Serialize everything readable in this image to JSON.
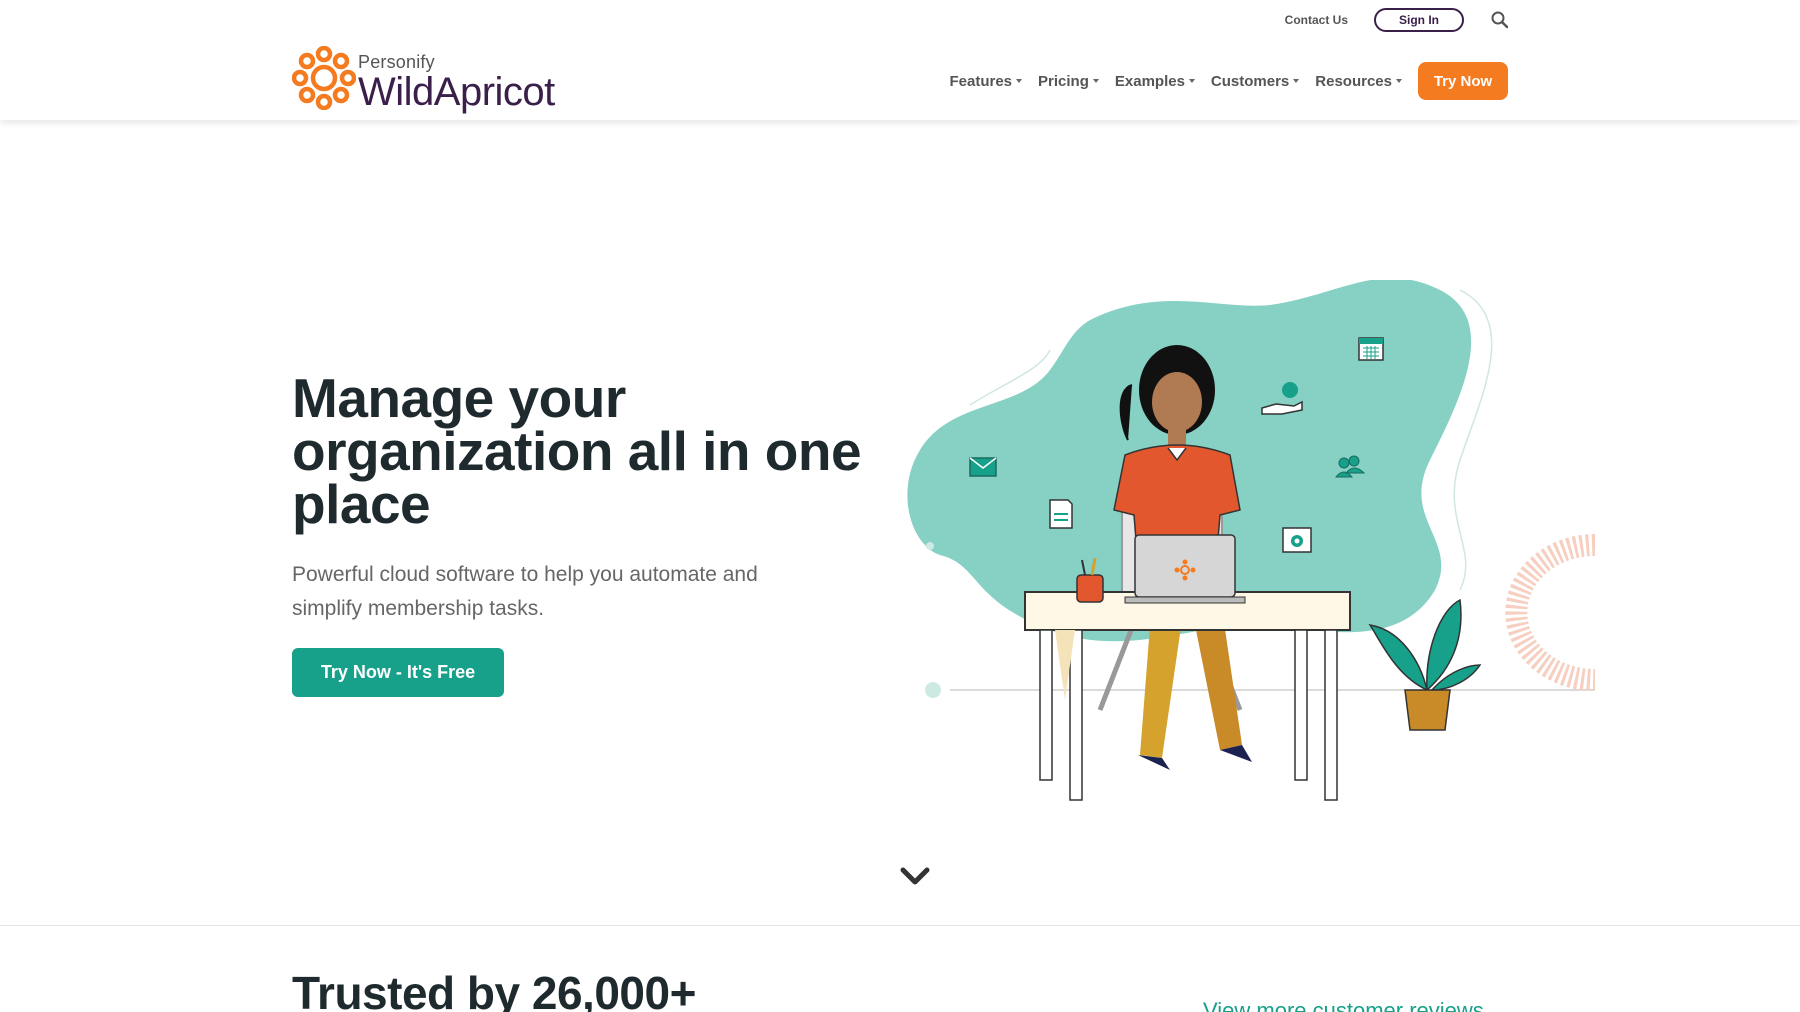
{
  "header": {
    "utility": {
      "contact_label": "Contact Us",
      "signin_label": "Sign In",
      "search_icon": "search-icon"
    },
    "logo": {
      "small": "Personify",
      "main": "WildApricot",
      "icon": "apricot-flower-icon"
    },
    "nav": {
      "items": [
        {
          "label": "Features"
        },
        {
          "label": "Pricing"
        },
        {
          "label": "Examples"
        },
        {
          "label": "Customers"
        },
        {
          "label": "Resources"
        }
      ],
      "try_label": "Try Now"
    }
  },
  "hero": {
    "title": "Manage your organization all in one place",
    "subtitle": "Powerful cloud software to help you automate and simplify membership tasks.",
    "cta_label": "Try Now - It's Free",
    "scroll_icon": "chevron-down-icon"
  },
  "trusted": {
    "heading": "Trusted by 26,000+",
    "reviews_link": "View more customer reviews"
  },
  "colors": {
    "accent_orange": "#f47b20",
    "accent_teal": "#17a08a",
    "brand_purple": "#3b1f4b",
    "blob_teal": "#86d0c4"
  }
}
